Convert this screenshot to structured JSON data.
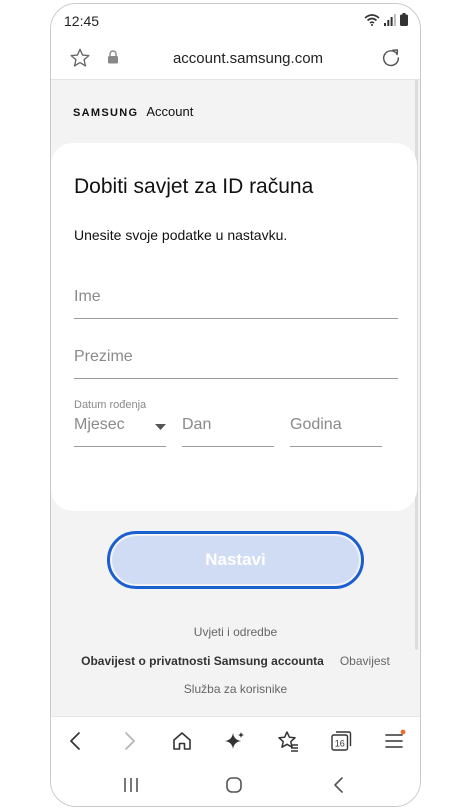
{
  "status": {
    "time": "12:45"
  },
  "browser": {
    "url": "account.samsung.com",
    "tab_count": "16",
    "icons": [
      "favorite-star-icon",
      "lock-icon",
      "reload-icon"
    ]
  },
  "brand": {
    "samsung": "SAMSUNG",
    "account": "Account"
  },
  "card": {
    "title": "Dobiti savjet za ID računa",
    "subtitle": "Unesite svoje podatke u nastavku.",
    "fields": {
      "first_name_placeholder": "Ime",
      "last_name_placeholder": "Prezime",
      "dob_label": "Datum rođenja",
      "month_placeholder": "Mjesec",
      "day_placeholder": "Dan",
      "year_placeholder": "Godina"
    }
  },
  "continue_button": {
    "label": "Nastavi",
    "highlight_color": "#1a5fd0",
    "fill_color": "#cfdcf3"
  },
  "footer": {
    "terms": "Uvjeti i odredbe",
    "privacy": "Obavijest o privatnosti Samsung accounta",
    "notice": "Obavijest",
    "support": "Služba za korisnike"
  },
  "toolbar_icons": [
    "back-icon",
    "forward-icon",
    "home-icon",
    "ai-sparkle-icon",
    "bookmarks-icon",
    "tabs-icon",
    "menu-icon"
  ],
  "system_nav_icons": [
    "recents-icon",
    "home-circle-icon",
    "back-chevron-icon"
  ]
}
